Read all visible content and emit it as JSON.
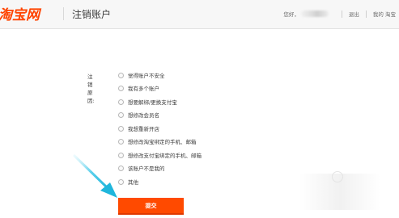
{
  "header": {
    "logo_text": "淘宝网",
    "page_title": "注销账户",
    "greeting": "您好，",
    "links": [
      "退出",
      "我的 淘宝"
    ]
  },
  "form": {
    "reason_label": "注销原因:",
    "options": [
      "觉得账户不安全",
      "我有多个账户",
      "想要解绑/更换支付宝",
      "想修改会员名",
      "我想重新开店",
      "想修改淘宝绑定的手机、邮箱",
      "想修改支付宝绑定的手机、邮箱",
      "该账户不是我的",
      "其他"
    ],
    "submit_label": "提交"
  },
  "colors": {
    "brand": "#ff4400",
    "submit_bg": "#ff4a00",
    "annotation_arrow": "#1fb6dc"
  },
  "icons": {
    "annotation": "arrow-pointer-icon"
  }
}
